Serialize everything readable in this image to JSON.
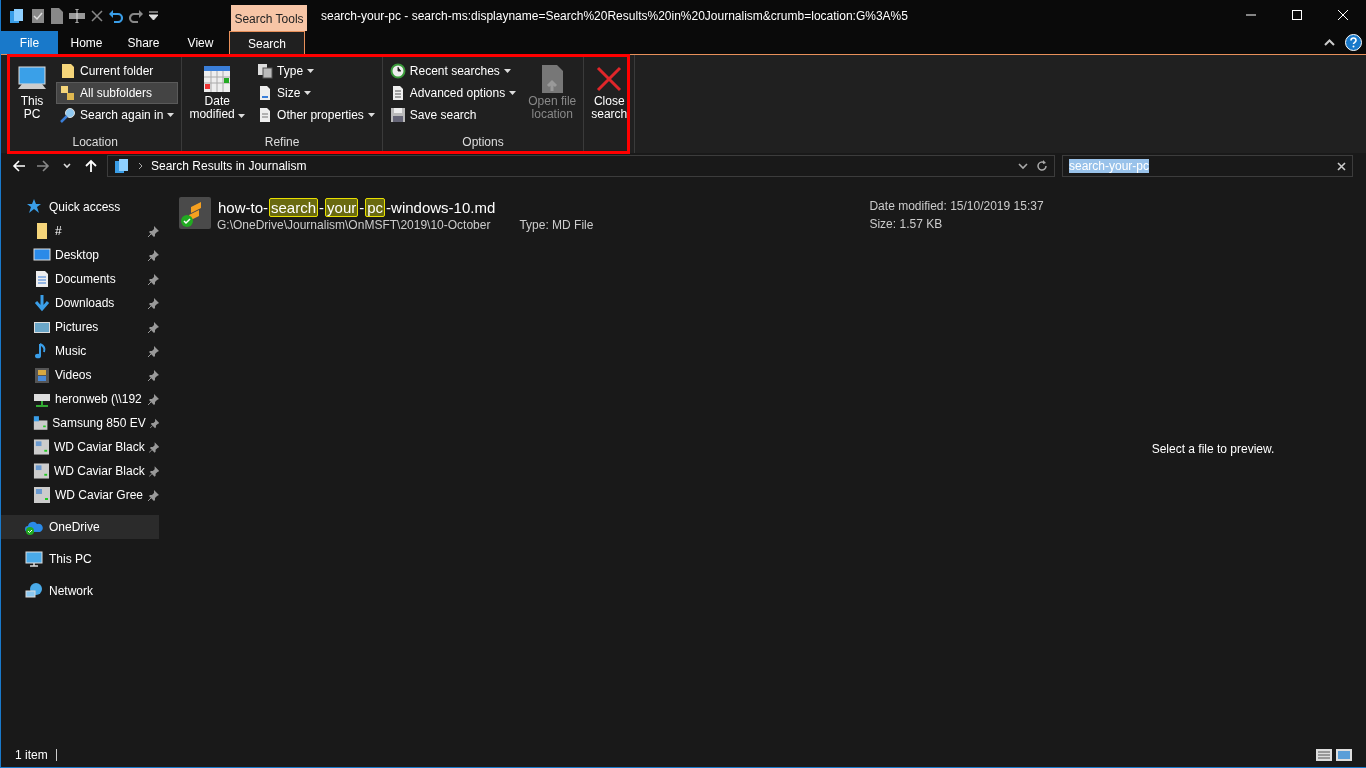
{
  "window": {
    "title": "search-your-pc - search-ms:displayname=Search%20Results%20in%20Journalism&crumb=location:G%3A%5",
    "context_label": "Search Tools"
  },
  "tabs": [
    {
      "label": "File",
      "kind": "file",
      "selected": false
    },
    {
      "label": "Home",
      "kind": "normal",
      "selected": false
    },
    {
      "label": "Share",
      "kind": "normal",
      "selected": false
    },
    {
      "label": "View",
      "kind": "normal",
      "selected": false
    },
    {
      "label": "Search",
      "kind": "contextual",
      "selected": true
    }
  ],
  "ribbon": {
    "groups": [
      {
        "label": "Location",
        "items": [
          {
            "kind": "large",
            "lines": [
              "This",
              "PC"
            ],
            "dropdown": false,
            "selected": false,
            "disabled": false
          },
          {
            "kind": "small",
            "lines": [
              "Current folder"
            ],
            "dropdown": false,
            "selected": false,
            "disabled": false
          },
          {
            "kind": "small",
            "lines": [
              "All subfolders"
            ],
            "dropdown": false,
            "selected": true,
            "disabled": false
          },
          {
            "kind": "small",
            "lines": [
              "Search again in"
            ],
            "dropdown": true,
            "selected": false,
            "disabled": false
          }
        ]
      },
      {
        "label": "Refine",
        "items": [
          {
            "kind": "large",
            "lines": [
              "Date",
              "modified"
            ],
            "dropdown": true,
            "selected": false,
            "disabled": false
          },
          {
            "kind": "small",
            "lines": [
              "Type"
            ],
            "dropdown": true,
            "selected": false,
            "disabled": false
          },
          {
            "kind": "small",
            "lines": [
              "Size"
            ],
            "dropdown": true,
            "selected": false,
            "disabled": false
          },
          {
            "kind": "small",
            "lines": [
              "Other properties"
            ],
            "dropdown": true,
            "selected": false,
            "disabled": false
          }
        ]
      },
      {
        "label": "Options",
        "items": [
          {
            "kind": "small",
            "lines": [
              "Recent searches"
            ],
            "dropdown": true,
            "selected": false,
            "disabled": false
          },
          {
            "kind": "small",
            "lines": [
              "Advanced options"
            ],
            "dropdown": true,
            "selected": false,
            "disabled": false
          },
          {
            "kind": "small",
            "lines": [
              "Save search"
            ],
            "dropdown": false,
            "selected": false,
            "disabled": false
          },
          {
            "kind": "large",
            "lines": [
              "Open file",
              "location"
            ],
            "dropdown": false,
            "selected": false,
            "disabled": true
          }
        ]
      },
      {
        "items": [
          {
            "kind": "large",
            "lines": [
              "Close",
              "search"
            ],
            "dropdown": false,
            "selected": false,
            "disabled": false
          }
        ]
      }
    ]
  },
  "address": {
    "breadcrumb": [
      "Search Results in Journalism"
    ]
  },
  "search": {
    "value": "search-your-pc",
    "text_selected": true
  },
  "sidebar": {
    "items": [
      {
        "label": "Quick access",
        "selected": false,
        "children": [
          {
            "label": "#",
            "pinned": true,
            "selected": false
          },
          {
            "label": "Desktop",
            "pinned": true,
            "selected": false
          },
          {
            "label": "Documents",
            "pinned": true,
            "selected": false
          },
          {
            "label": "Downloads",
            "pinned": true,
            "selected": false
          },
          {
            "label": "Pictures",
            "pinned": true,
            "selected": false
          },
          {
            "label": "Music",
            "pinned": true,
            "selected": false
          },
          {
            "label": "Videos",
            "pinned": true,
            "selected": false
          },
          {
            "label": "heronweb (\\\\192",
            "pinned": true,
            "selected": false
          },
          {
            "label": "Samsung 850 EV",
            "pinned": true,
            "selected": false
          },
          {
            "label": "WD Caviar Black",
            "pinned": true,
            "selected": false
          },
          {
            "label": "WD Caviar Black",
            "pinned": true,
            "selected": false
          },
          {
            "label": "WD Caviar Gree",
            "pinned": true,
            "selected": false
          }
        ]
      },
      {
        "label": "OneDrive",
        "selected": true
      },
      {
        "label": "This PC",
        "selected": false
      },
      {
        "label": "Network",
        "selected": false
      }
    ]
  },
  "results": [
    {
      "name_parts": [
        {
          "text": "how-to-",
          "match": false
        },
        {
          "text": "search",
          "match": true
        },
        {
          "text": "-",
          "match": false
        },
        {
          "text": "your",
          "match": true
        },
        {
          "text": "-",
          "match": false
        },
        {
          "text": "pc",
          "match": true
        },
        {
          "text": "-windows-10.md",
          "match": false
        }
      ],
      "path": "G:\\OneDrive\\Journalism\\OnMSFT\\2019\\10-October",
      "type": "Type: MD File",
      "date": "Date modified: 15/10/2019 15:37",
      "size": "Size: 1.57 KB",
      "synced": true
    }
  ],
  "preview": {
    "message": "Select a file to preview."
  },
  "status_bar": {
    "count": "1 item"
  }
}
